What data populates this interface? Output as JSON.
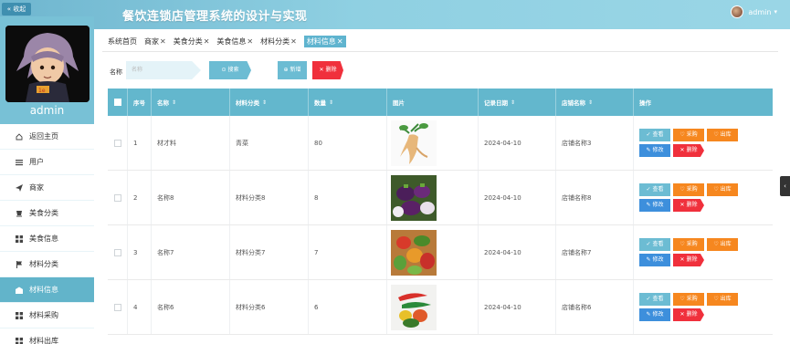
{
  "header": {
    "collapse_label": "« 收起",
    "system_title": "餐饮连锁店管理系统的设计与实现",
    "user_name": "admin"
  },
  "sidebar": {
    "admin_label": "admin",
    "items": [
      {
        "label": "返回主页",
        "icon": "home-icon"
      },
      {
        "label": "用户",
        "icon": "list-icon"
      },
      {
        "label": "商家",
        "icon": "send-icon"
      },
      {
        "label": "美食分类",
        "icon": "cup-icon"
      },
      {
        "label": "美食信息",
        "icon": "grid-icon"
      },
      {
        "label": "材料分类",
        "icon": "flag-icon"
      },
      {
        "label": "材料信息",
        "icon": "box-icon",
        "active": true
      },
      {
        "label": "材料采购",
        "icon": "grid-icon"
      },
      {
        "label": "材料出库",
        "icon": "grid-icon"
      }
    ]
  },
  "tags": [
    {
      "label": "系统首页",
      "closable": false
    },
    {
      "label": "商家",
      "closable": true
    },
    {
      "label": "美食分类",
      "closable": true
    },
    {
      "label": "美食信息",
      "closable": true
    },
    {
      "label": "材料分类",
      "closable": true
    },
    {
      "label": "材料信息",
      "closable": true,
      "active": true
    }
  ],
  "search": {
    "label": "名称",
    "placeholder": "名称",
    "search_btn": "⊙ 搜索",
    "add_btn": "⊕ 新增",
    "delete_btn": "✕ 删除"
  },
  "table": {
    "headers": {
      "no": "序号",
      "name": "名称",
      "category": "材料分类",
      "qty": "数量",
      "image": "图片",
      "date": "记录日期",
      "store": "店铺名称",
      "op": "操作"
    },
    "rows": [
      {
        "no": "1",
        "name": "材才料",
        "category": "青菜",
        "qty": "80",
        "date": "2024-04-10",
        "store": "店铺名称3",
        "image": "ginseng"
      },
      {
        "no": "2",
        "name": "名称8",
        "category": "材料分类8",
        "qty": "8",
        "date": "2024-04-10",
        "store": "店铺名称8",
        "image": "eggplant"
      },
      {
        "no": "3",
        "name": "名称7",
        "category": "材料分类7",
        "qty": "7",
        "date": "2024-04-10",
        "store": "店铺名称7",
        "image": "veggies"
      },
      {
        "no": "4",
        "name": "名称6",
        "category": "材料分类6",
        "qty": "6",
        "date": "2024-04-10",
        "store": "店铺名称6",
        "image": "peppers"
      }
    ],
    "ops": {
      "view": "✓ 查看",
      "buy": "♡ 采购",
      "out": "♡ 出库",
      "edit": "✎ 修改",
      "delete": "✕ 删除"
    }
  },
  "colors": {
    "accent": "#63b7cd",
    "orange": "#f6871f",
    "blue": "#3d8fdc",
    "red": "#f0303c"
  }
}
